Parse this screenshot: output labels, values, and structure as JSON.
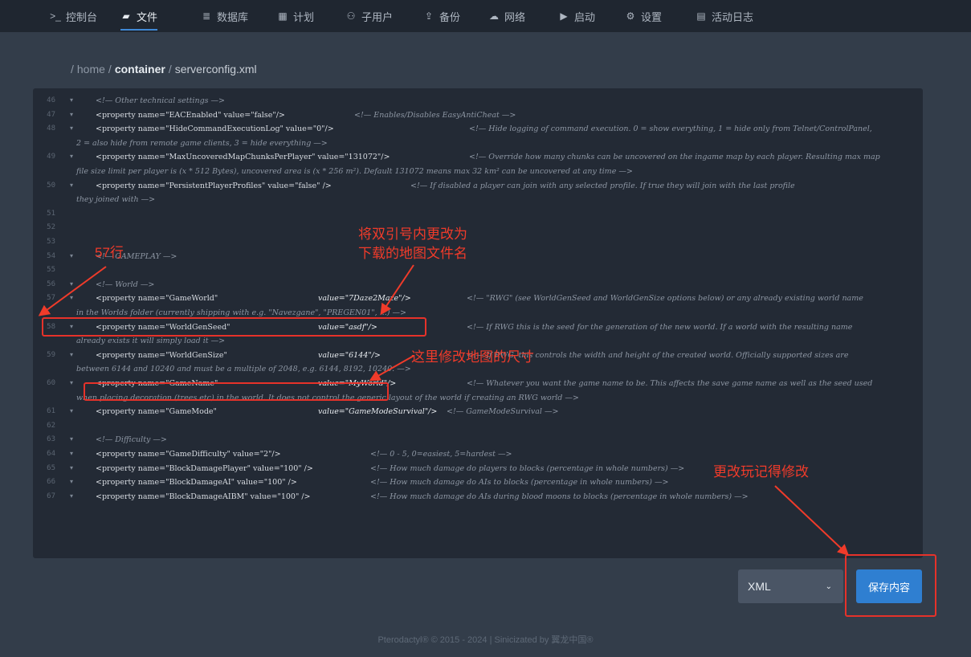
{
  "nav": {
    "items": [
      {
        "label": "控制台",
        "icon": "terminal-icon",
        "glyph": ">_"
      },
      {
        "label": "文件",
        "icon": "folder-icon",
        "glyph": "▰"
      },
      {
        "label": "数据库",
        "icon": "database-icon",
        "glyph": "≣"
      },
      {
        "label": "计划",
        "icon": "calendar-icon",
        "glyph": "▦"
      },
      {
        "label": "子用户",
        "icon": "users-icon",
        "glyph": "⚇"
      },
      {
        "label": "备份",
        "icon": "upload-icon",
        "glyph": "⇪"
      },
      {
        "label": "网络",
        "icon": "network-icon",
        "glyph": "☁"
      },
      {
        "label": "启动",
        "icon": "play-icon",
        "glyph": "▶"
      },
      {
        "label": "设置",
        "icon": "gears-icon",
        "glyph": "⚙"
      },
      {
        "label": "活动日志",
        "icon": "log-icon",
        "glyph": "▤"
      }
    ],
    "active": "文件"
  },
  "breadcrumb": {
    "sep1": "/",
    "part1": "home",
    "sep2": "/",
    "part2": "container",
    "sep3": "/",
    "file": "serverconfig.xml"
  },
  "editor": {
    "lines": [
      {
        "num": "46",
        "fold": "▾",
        "comment": "<!— Other technical settings —>"
      },
      {
        "num": "47",
        "fold": "▾",
        "tag": "<property name=\"EACEnabled\" value=\"false\"/>",
        "comment": "<!— Enables/Disables EasyAntiCheat —>"
      },
      {
        "num": "48",
        "fold": "▾",
        "tag": "<property name=\"HideCommandExecutionLog\"        value=\"0\"/>",
        "comment": "<!— Hide logging of command execution. 0 = show everything, 1 = hide only from Telnet/ControlPanel,",
        "wrap": "2 = also hide from remote game clients, 3 = hide everything —>"
      },
      {
        "num": "49",
        "fold": "▾",
        "tag": "<property name=\"MaxUncoveredMapChunksPerPlayer\" value=\"131072\"/>",
        "comment": "<!— Override how many chunks can be uncovered on the ingame map by each player. Resulting max map",
        "wrap": "file size limit per player is (x * 512 Bytes), uncovered area is (x * 256 m²). Default 131072 means max 32 km² can be uncovered at any time —>"
      },
      {
        "num": "50",
        "fold": "▾",
        "tag": "<property name=\"PersistentPlayerProfiles\" value=\"false\" />",
        "comment": "<!— If disabled a player can join with any selected profile. If true they will join with the last profile",
        "wrap": "they joined with —>"
      },
      {
        "num": "51"
      },
      {
        "num": "52"
      },
      {
        "num": "53"
      },
      {
        "num": "54",
        "fold": "▾",
        "comment": "<!— GAMEPLAY —>"
      },
      {
        "num": "55"
      },
      {
        "num": "56",
        "fold": "▾",
        "comment": "<!— World —>"
      },
      {
        "num": "57",
        "fold": "▾",
        "tag": "<property name=\"GameWorld\"",
        "value": "value=\"7Daze2Maze\"/>",
        "comment": "<!— \"RWG\" (see WorldGenSeed and WorldGenSize options below) or any already existing world name",
        "wrap": "in the Worlds folder (currently shipping with e.g. \"Navezgane\", \"PREGEN01\", ...) —>"
      },
      {
        "num": "58",
        "fold": "▾",
        "tag": "<property name=\"WorldGenSeed\"",
        "value": "value=\"asdf\"/>",
        "comment": "<!— If RWG this is the seed for the generation of the new world. If a world with the resulting name",
        "wrap": "already exists it will simply load it —>"
      },
      {
        "num": "59",
        "fold": "▾",
        "tag": "<property name=\"WorldGenSize\"",
        "value": "value=\"6144\"/>",
        "comment": "<!— If RWG, this controls the width and height of the created world. Officially supported sizes are",
        "wrap": "between 6144 and 10240 and must be a multiple of 2048, e.g. 6144, 8192, 10240. —>"
      },
      {
        "num": "60",
        "fold": "▾",
        "tag": "<property name=\"GameName\"",
        "value": "value=\"MyWorld\"/>",
        "comment": "<!— Whatever you want the game name to be. This affects the save game name as well as the seed used",
        "wrap": "when placing decoration (trees etc) in the world. It does not control the generic layout of the world if creating an RWG world —>"
      },
      {
        "num": "61",
        "fold": "▾",
        "tag": "<property name=\"GameMode\"",
        "value": "value=\"GameModeSurvival\"/>",
        "comment": "<!— GameModeSurvival —>"
      },
      {
        "num": "62"
      },
      {
        "num": "63",
        "fold": "▾",
        "comment": "<!— Difficulty —>"
      },
      {
        "num": "64",
        "fold": "▾",
        "tag": "<property name=\"GameDifficulty\" value=\"2\"/>",
        "comment": "<!— 0 - 5, 0=easiest, 5=hardest —>"
      },
      {
        "num": "65",
        "fold": "▾",
        "tag": "<property name=\"BlockDamagePlayer\" value=\"100\" />",
        "comment": "<!— How much damage do players to blocks (percentage in whole numbers) —>"
      },
      {
        "num": "66",
        "fold": "▾",
        "tag": "<property name=\"BlockDamageAI\" value=\"100\" />",
        "comment": "<!— How much damage do AIs to blocks (percentage in whole numbers) —>"
      },
      {
        "num": "67",
        "fold": "▾",
        "tag": "<property name=\"BlockDamageAIBM\" value=\"100\" />",
        "comment": "<!— How much damage do AIs during blood moons to blocks (percentage in whole numbers) —>"
      }
    ]
  },
  "annotations": {
    "line57": "57行",
    "change_name_1": "将双引号内更改为",
    "change_name_2": "下载的地图文件名",
    "size_note": "这里修改地图的尺寸",
    "save_note": "更改玩记得修改"
  },
  "controls": {
    "language": "XML",
    "save_label": "保存内容"
  },
  "footer": "Pterodactyl® © 2015 - 2024 | Sinicizated by 翼龙中国®",
  "colors": {
    "accent": "#2f7fd1",
    "annotation": "#f03b2a"
  }
}
